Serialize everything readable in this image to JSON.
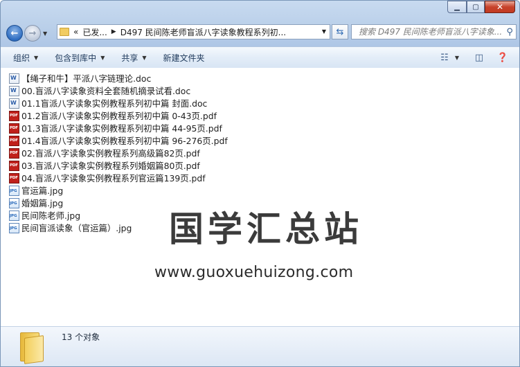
{
  "nav": {
    "address_prefix": "«",
    "address_parent": "已发...",
    "address_current": "D497 民间陈老师盲派八字读象教程系列初...",
    "search_placeholder": "搜索 D497 民间陈老师盲派八字读象..."
  },
  "toolbar": {
    "organize": "组织",
    "include_in_library": "包含到库中",
    "share": "共享",
    "new_folder": "新建文件夹"
  },
  "files": [
    {
      "name": "【绳子和牛】平派八字链理论.doc",
      "icon": "doc"
    },
    {
      "name": "00.盲派八字读象资料全套随机摘录试看.doc",
      "icon": "doc"
    },
    {
      "name": "01.1盲派八字读象实例教程系列初中篇 封面.doc",
      "icon": "doc"
    },
    {
      "name": "01.2盲派八字读象实例教程系列初中篇 0-43页.pdf",
      "icon": "pdf"
    },
    {
      "name": "01.3盲派八字读象实例教程系列初中篇 44-95页.pdf",
      "icon": "pdf"
    },
    {
      "name": "01.4盲派八字读象实例教程系列初中篇 96-276页.pdf",
      "icon": "pdf"
    },
    {
      "name": "02.盲派八字读象实例教程系列高级篇82页.pdf",
      "icon": "pdf"
    },
    {
      "name": "03.盲派八字读象实例教程系列婚姻篇80页.pdf",
      "icon": "pdf"
    },
    {
      "name": "04.盲派八字读象实例教程系列官运篇139页.pdf",
      "icon": "pdf"
    },
    {
      "name": "官运篇.jpg",
      "icon": "jpg"
    },
    {
      "name": "婚姻篇.jpg",
      "icon": "jpg"
    },
    {
      "name": "民间陈老师.jpg",
      "icon": "jpg"
    },
    {
      "name": "民间盲派读象（官运篇）.jpg",
      "icon": "jpg"
    }
  ],
  "watermark": {
    "cn": "国学汇总站",
    "url": "www.guoxuehuizong.com"
  },
  "details": {
    "count": "13 个对象"
  },
  "colors": {
    "frame": "#b9cfe9",
    "pdf_icon": "#c0201b",
    "close_button": "#c7432c"
  }
}
